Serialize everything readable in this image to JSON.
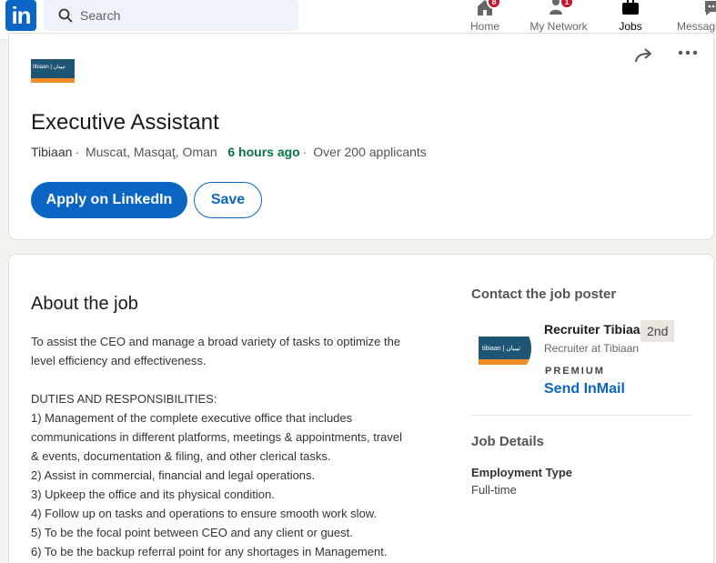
{
  "nav": {
    "logo_text": "in",
    "search_placeholder": "Search",
    "items": [
      {
        "label": "Home",
        "badge": "8"
      },
      {
        "label": "My Network",
        "badge": "1"
      },
      {
        "label": "Jobs",
        "badge": ""
      },
      {
        "label": "Messaging",
        "badge": ""
      }
    ],
    "active": "Jobs"
  },
  "job": {
    "company_logo_text": "tibiaan | تيبيان",
    "title": "Executive Assistant",
    "company": "Tibiaan",
    "location": "Muscat, Masqaţ, Oman",
    "posted": "6 hours ago",
    "applicants": "Over 200 applicants",
    "apply_label": "Apply on LinkedIn",
    "save_label": "Save"
  },
  "about": {
    "title": "About the job",
    "lines": [
      "To assist the CEO and manage a broad variety of tasks to optimize the",
      "level efficiency and effectiveness.",
      "",
      "DUTIES AND RESPONSIBILITIES:",
      "1) Management of the complete executive office that includes",
      "communications in different platforms, meetings & appointments, travel",
      "& events, documentation & filing, and other clerical tasks.",
      "2) Assist in commercial, financial and legal operations.",
      "3) Upkeep the office and its physical condition.",
      "4) Follow up on tasks and operations to ensure smooth work slow.",
      "5) To be the focal point between CEO and any client or guest.",
      "6) To be the backup referral point for any shortages in Management."
    ]
  },
  "contact": {
    "title": "Contact the job poster",
    "name": "Recruiter Tibiaan",
    "degree": "2nd",
    "subtitle": "Recruiter at Tibiaan",
    "premium": "PREMIUM",
    "inmail_label": "Send InMail"
  },
  "details": {
    "title": "Job Details",
    "employment_label": "Employment Type",
    "employment_value": "Full-time"
  },
  "colors": {
    "brand": "#0a66c2",
    "posted_green": "#057642",
    "badge_red": "#cb112d"
  }
}
